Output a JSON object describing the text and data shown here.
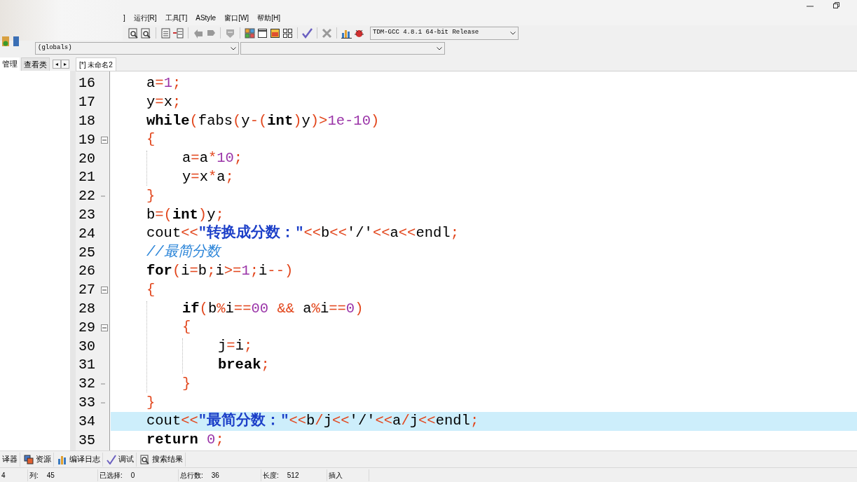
{
  "menu": [
    {
      "label": "]"
    },
    {
      "label": "运行[R]"
    },
    {
      "label": "工具[T]"
    },
    {
      "label": "AStyle"
    },
    {
      "label": "窗口[W]"
    },
    {
      "label": "帮助[H]"
    }
  ],
  "toolbar": {
    "compiler": "TDM-GCC 4.8.1 64-bit Release"
  },
  "scope_bar": {
    "scope": "(globals)"
  },
  "left_panel": {
    "tabs": [
      {
        "label": "管理",
        "selected": true
      },
      {
        "label": "查看类",
        "selected": false
      }
    ],
    "arrows": [
      "◂",
      "▸"
    ]
  },
  "editor": {
    "tabs": [
      {
        "label": "[*] 未命名2",
        "selected": true
      }
    ],
    "lines": [
      {
        "no": "16",
        "current": false,
        "collapsible": false,
        "block_end": false,
        "tokens": [
          {
            "kind": "id",
            "text": "a"
          },
          {
            "kind": "op",
            "text": "="
          },
          {
            "kind": "num",
            "text": "1"
          },
          {
            "kind": "op",
            "text": ";"
          }
        ]
      },
      {
        "no": "17",
        "current": false,
        "collapsible": false,
        "block_end": false,
        "tokens": [
          {
            "kind": "id",
            "text": "y"
          },
          {
            "kind": "op",
            "text": "="
          },
          {
            "kind": "id",
            "text": "x"
          },
          {
            "kind": "op",
            "text": ";"
          }
        ]
      },
      {
        "no": "18",
        "current": false,
        "collapsible": false,
        "block_end": false,
        "tokens": [
          {
            "kind": "kw",
            "text": "while"
          },
          {
            "kind": "op",
            "text": "("
          },
          {
            "kind": "id",
            "text": "fabs"
          },
          {
            "kind": "op",
            "text": "("
          },
          {
            "kind": "id",
            "text": "y"
          },
          {
            "kind": "op",
            "text": "-("
          },
          {
            "kind": "kw",
            "text": "int"
          },
          {
            "kind": "op",
            "text": ")"
          },
          {
            "kind": "id",
            "text": "y"
          },
          {
            "kind": "op",
            "text": ")>"
          },
          {
            "kind": "num",
            "text": "1e-10"
          },
          {
            "kind": "op",
            "text": ")"
          }
        ]
      },
      {
        "no": "19",
        "current": false,
        "collapsible": true,
        "block_end": false,
        "tokens": [
          {
            "kind": "op",
            "text": "{"
          }
        ],
        "children": [
          {
            "no": "20",
            "current": false,
            "collapsible": false,
            "block_end": false,
            "tokens": [
              {
                "kind": "id",
                "text": "a"
              },
              {
                "kind": "op",
                "text": "="
              },
              {
                "kind": "id",
                "text": "a"
              },
              {
                "kind": "op",
                "text": "*"
              },
              {
                "kind": "num",
                "text": "10"
              },
              {
                "kind": "op",
                "text": ";"
              }
            ]
          },
          {
            "no": "21",
            "current": false,
            "collapsible": false,
            "block_end": false,
            "tokens": [
              {
                "kind": "id",
                "text": "y"
              },
              {
                "kind": "op",
                "text": "="
              },
              {
                "kind": "id",
                "text": "x"
              },
              {
                "kind": "op",
                "text": "*"
              },
              {
                "kind": "id",
                "text": "a"
              },
              {
                "kind": "op",
                "text": ";"
              }
            ]
          }
        ]
      },
      {
        "no": "22",
        "current": false,
        "collapsible": false,
        "block_end": true,
        "tokens": [
          {
            "kind": "op",
            "text": "}"
          }
        ]
      },
      {
        "no": "23",
        "current": false,
        "collapsible": false,
        "block_end": false,
        "tokens": [
          {
            "kind": "id",
            "text": "b"
          },
          {
            "kind": "op",
            "text": "=("
          },
          {
            "kind": "kw",
            "text": "int"
          },
          {
            "kind": "op",
            "text": ")"
          },
          {
            "kind": "id",
            "text": "y"
          },
          {
            "kind": "op",
            "text": ";"
          }
        ]
      },
      {
        "no": "24",
        "current": false,
        "collapsible": false,
        "block_end": false,
        "tokens": [
          {
            "kind": "id",
            "text": "cout"
          },
          {
            "kind": "op",
            "text": "<<"
          },
          {
            "kind": "str",
            "text": "\"转换成分数：\""
          },
          {
            "kind": "op",
            "text": "<<"
          },
          {
            "kind": "id",
            "text": "b"
          },
          {
            "kind": "op",
            "text": "<<"
          },
          {
            "kind": "id",
            "text": "'/'"
          },
          {
            "kind": "op",
            "text": "<<"
          },
          {
            "kind": "id",
            "text": "a"
          },
          {
            "kind": "op",
            "text": "<<"
          },
          {
            "kind": "id",
            "text": "endl"
          },
          {
            "kind": "op",
            "text": ";"
          }
        ]
      },
      {
        "no": "25",
        "current": false,
        "collapsible": false,
        "block_end": false,
        "tokens": [
          {
            "kind": "cmt",
            "text": "//最简分数"
          }
        ]
      },
      {
        "no": "26",
        "current": false,
        "collapsible": false,
        "block_end": false,
        "tokens": [
          {
            "kind": "kw",
            "text": "for"
          },
          {
            "kind": "op",
            "text": "("
          },
          {
            "kind": "id",
            "text": "i"
          },
          {
            "kind": "op",
            "text": "="
          },
          {
            "kind": "id",
            "text": "b"
          },
          {
            "kind": "op",
            "text": ";"
          },
          {
            "kind": "id",
            "text": "i"
          },
          {
            "kind": "op",
            "text": ">="
          },
          {
            "kind": "num",
            "text": "1"
          },
          {
            "kind": "op",
            "text": ";"
          },
          {
            "kind": "id",
            "text": "i"
          },
          {
            "kind": "op",
            "text": "--)"
          }
        ]
      },
      {
        "no": "27",
        "current": false,
        "collapsible": true,
        "block_end": false,
        "tokens": [
          {
            "kind": "op",
            "text": "{"
          }
        ],
        "children": [
          {
            "no": "28",
            "current": false,
            "collapsible": false,
            "block_end": false,
            "tokens": [
              {
                "kind": "kw",
                "text": "if"
              },
              {
                "kind": "op",
                "text": "("
              },
              {
                "kind": "id",
                "text": "b"
              },
              {
                "kind": "op",
                "text": "%"
              },
              {
                "kind": "id",
                "text": "i"
              },
              {
                "kind": "op",
                "text": "=="
              },
              {
                "kind": "num",
                "text": "00"
              },
              {
                "kind": "op",
                "text": " && "
              },
              {
                "kind": "id",
                "text": "a"
              },
              {
                "kind": "op",
                "text": "%"
              },
              {
                "kind": "id",
                "text": "i"
              },
              {
                "kind": "op",
                "text": "=="
              },
              {
                "kind": "num",
                "text": "0"
              },
              {
                "kind": "op",
                "text": ")"
              }
            ]
          },
          {
            "no": "29",
            "current": false,
            "collapsible": true,
            "block_end": false,
            "tokens": [
              {
                "kind": "op",
                "text": "{"
              }
            ],
            "children": [
              {
                "no": "30",
                "current": false,
                "collapsible": false,
                "block_end": false,
                "tokens": [
                  {
                    "kind": "id",
                    "text": "j"
                  },
                  {
                    "kind": "op",
                    "text": "="
                  },
                  {
                    "kind": "id",
                    "text": "i"
                  },
                  {
                    "kind": "op",
                    "text": ";"
                  }
                ]
              },
              {
                "no": "31",
                "current": false,
                "collapsible": false,
                "block_end": false,
                "tokens": [
                  {
                    "kind": "kw",
                    "text": "break"
                  },
                  {
                    "kind": "op",
                    "text": ";"
                  }
                ]
              }
            ]
          },
          {
            "no": "32",
            "current": false,
            "collapsible": false,
            "block_end": true,
            "tokens": [
              {
                "kind": "op",
                "text": "}"
              }
            ]
          }
        ]
      },
      {
        "no": "33",
        "current": false,
        "collapsible": false,
        "block_end": true,
        "tokens": [
          {
            "kind": "op",
            "text": "}"
          }
        ]
      },
      {
        "no": "34",
        "current": true,
        "collapsible": false,
        "block_end": false,
        "tokens": [
          {
            "kind": "id",
            "text": "cout"
          },
          {
            "kind": "op",
            "text": "<<"
          },
          {
            "kind": "str",
            "text": "\"最简分数：\""
          },
          {
            "kind": "op",
            "text": "<<"
          },
          {
            "kind": "id",
            "text": "b"
          },
          {
            "kind": "op",
            "text": "/"
          },
          {
            "kind": "id",
            "text": "j"
          },
          {
            "kind": "op",
            "text": "<<"
          },
          {
            "kind": "id",
            "text": "'/'"
          },
          {
            "kind": "op",
            "text": "<<"
          },
          {
            "kind": "id",
            "text": "a"
          },
          {
            "kind": "op",
            "text": "/"
          },
          {
            "kind": "id",
            "text": "j"
          },
          {
            "kind": "op",
            "text": "<<"
          },
          {
            "kind": "id",
            "text": "endl"
          },
          {
            "kind": "op",
            "text": ";"
          }
        ]
      },
      {
        "no": "35",
        "current": false,
        "collapsible": false,
        "block_end": false,
        "tokens": [
          {
            "kind": "kw",
            "text": "return"
          },
          {
            "kind": "num",
            "text": "0",
            "space_before": true
          },
          {
            "kind": "op",
            "text": ";"
          }
        ]
      }
    ]
  },
  "bottom_tabs": [
    {
      "label": "译器"
    },
    {
      "label": "资源"
    },
    {
      "label": "编译日志"
    },
    {
      "label": "调试"
    },
    {
      "label": "搜索结果"
    }
  ],
  "status_bar": [
    {
      "value": "4"
    },
    {
      "label": "列:",
      "value": "45"
    },
    {
      "label": "已选择:",
      "value": "0"
    },
    {
      "label": "总行数:",
      "value": "36"
    },
    {
      "label": "长度:",
      "value": "512"
    },
    {
      "value": "插入"
    }
  ]
}
